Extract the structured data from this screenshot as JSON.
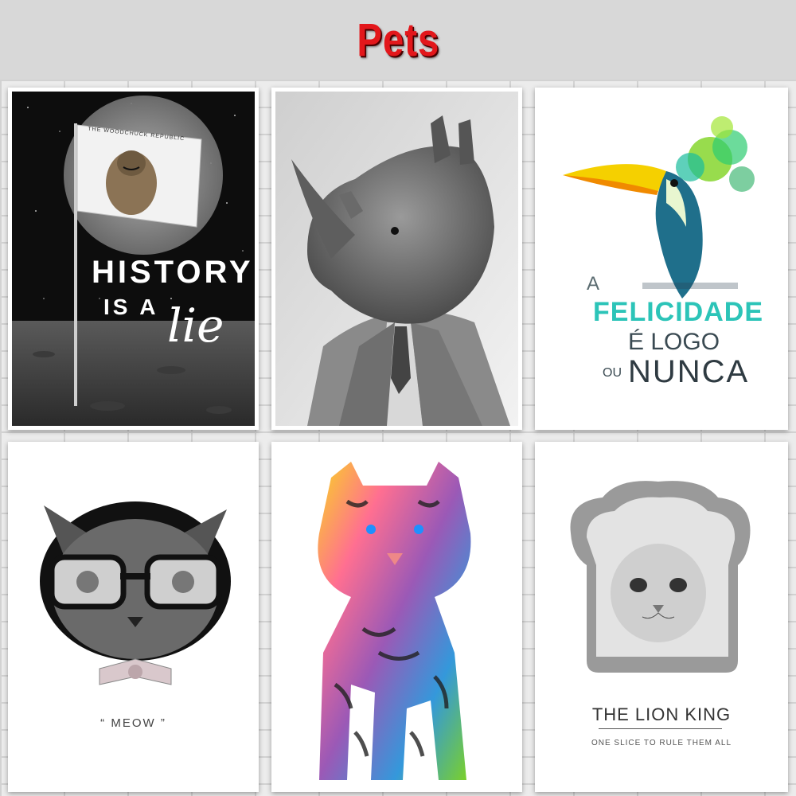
{
  "header": {
    "title": "Pets"
  },
  "posters": [
    {
      "flag_text": "THE WOODCHUCK REPUBLIC",
      "line1": "HISTORY",
      "line2": "IS A",
      "line3": "lie"
    },
    {
      "subject": "rhino-in-suit"
    },
    {
      "line1": "A",
      "line2": "FELICIDADE",
      "line3": "É LOGO",
      "line4a": "OU",
      "line4b": "NUNCA"
    },
    {
      "caption": "“ MEOW ”"
    },
    {
      "subject": "rainbow-tiger"
    },
    {
      "title": "THE LION KING",
      "subtitle": "ONE SLICE TO RULE THEM ALL"
    }
  ]
}
